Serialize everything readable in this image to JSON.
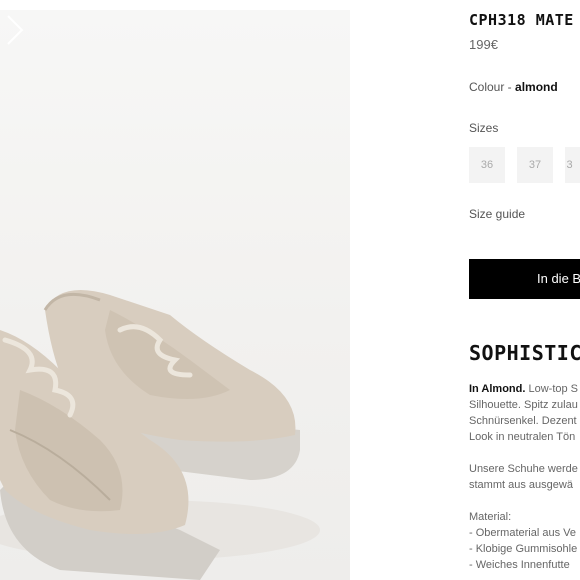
{
  "product": {
    "title": "CPH318 MATE",
    "price": "199€",
    "colour_label": "Colour - ",
    "colour_value": "almond",
    "sizes_label": "Sizes",
    "sizes": [
      "36",
      "37",
      "3"
    ],
    "size_guide": "Size guide",
    "cart_button": "In die B"
  },
  "gallery": {
    "next_icon": "chevron-right-icon",
    "image_alt": "almond chunky sneakers"
  },
  "description": {
    "heading": "SOPHISTICAT",
    "p1_strong": "In Almond.",
    "p1_rest": " Low-top S",
    "lines": [
      "Silhouette. Spitz zulau",
      "Schnürsenkel. Dezent",
      "Look in neutralen Tön"
    ],
    "p2_lines": [
      "Unsere Schuhe werde",
      "stammt aus ausgewä"
    ],
    "material_label": "Material:",
    "material_items": [
      "- Obermaterial aus Ve",
      "- Klobige Gummisohle",
      "- Weiches Innenfutte"
    ]
  },
  "colors": {
    "button_bg": "#000000",
    "size_box_bg": "#f3f3f3",
    "shoe": "#d8cdbf"
  }
}
